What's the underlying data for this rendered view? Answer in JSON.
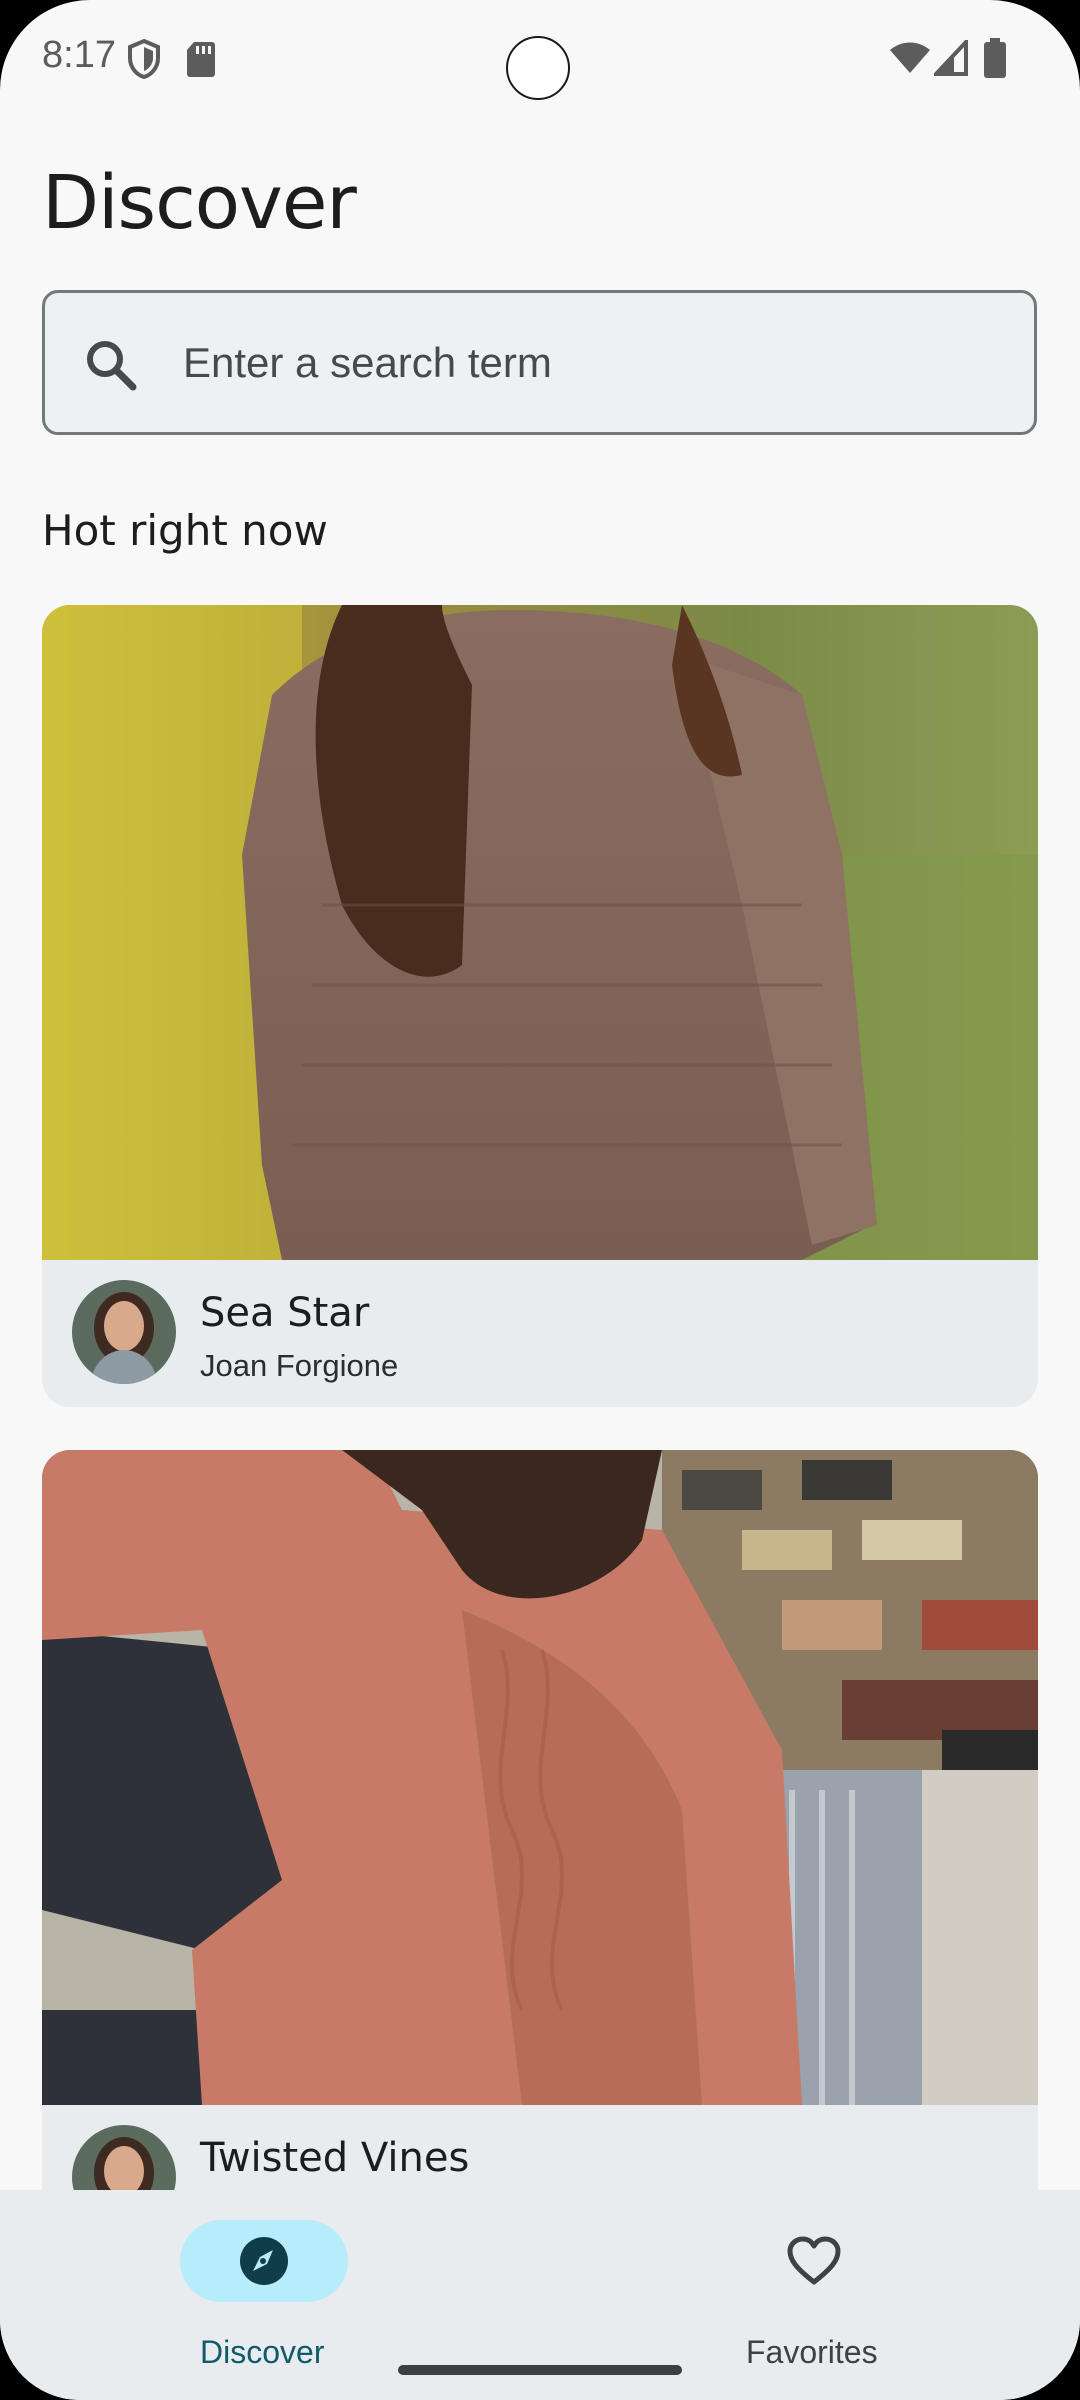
{
  "status_bar": {
    "time": "8:17"
  },
  "page": {
    "title": "Discover"
  },
  "search": {
    "placeholder": "Enter a search term"
  },
  "section": {
    "title": "Hot right now"
  },
  "cards": [
    {
      "title": "Sea Star",
      "designer": "Joan Forgione"
    },
    {
      "title": "Twisted Vines",
      "designer": ""
    }
  ],
  "nav": {
    "items": [
      {
        "label": "Discover",
        "icon": "compass-icon",
        "selected": true
      },
      {
        "label": "Favorites",
        "icon": "heart-icon",
        "selected": false
      }
    ]
  },
  "colors": {
    "background": "#f8f8f8",
    "accent_pill": "#b6ecfb",
    "accent_text": "#0f5b6b",
    "card_bg": "#e8ecef"
  }
}
